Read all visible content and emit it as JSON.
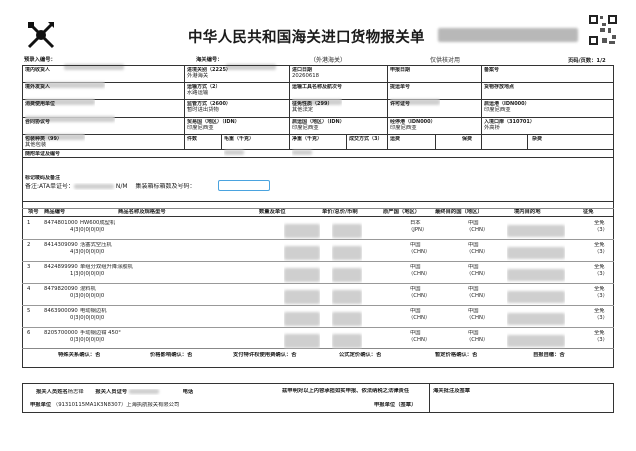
{
  "header": {
    "title": "中华人民共和国海关进口货物报关单",
    "preentry_label": "预录入编号：",
    "customs_no_label": "海关编号：",
    "customs_note": "（外港海关）",
    "usage": "仅供核对用",
    "page": "页码/页数：1/2"
  },
  "fields": {
    "consignee_domestic": "境内收货人",
    "entry_customs_label": "进境关别（2225）",
    "entry_customs_value": "外港海关",
    "import_date_label": "进口日期",
    "import_date_value": "20260618",
    "declare_date_label": "申报日期",
    "record_no_label": "备案号",
    "consignor_overseas": "境外发货人",
    "transport_mode_label": "运输方式（2）",
    "transport_mode_value": "水路运输",
    "vessel_label": "运输工具名称及航次号",
    "bill_no_label": "提运单号",
    "storage_label": "货物存放地点",
    "consumer_unit": "消费使用单位",
    "supervision_label": "监管方式（2600）",
    "supervision_value": "暂时进出货物",
    "tax_nature_label": "征免性质（299）",
    "tax_nature_value": "其他法定",
    "license_label": "许可证号",
    "departure_port_label": "启运港（IDN000）",
    "departure_port_value": "印度尼西亚",
    "contract_label": "合同协议号",
    "trade_country_label": "贸易国（地区）（IDN）",
    "trade_country_value": "印度尼西亚",
    "origin_country_label": "启运国（地区）（IDN）",
    "origin_country_value": "印度尼西亚",
    "via_port_label": "经停港（IDN000）",
    "via_port_value": "印度尼西亚",
    "entry_port_label": "入境口岸（310701）",
    "entry_port_value": "外高桥",
    "packaging_label": "包装种类（99）",
    "packaging_value": "其他包装",
    "pieces_label": "件数",
    "gross_label": "毛重（千克）",
    "net_label": "净重（千克）",
    "deal_mode_label": "成交方式（3）",
    "freight_label": "运费",
    "insurance_label": "保费",
    "misc_label": "杂费",
    "docs_label": "随附单证及编号",
    "marks_label": "标记唛码及备注",
    "remark_prefix": "备注:ATA单证号：",
    "remark_nm": "N/M",
    "remark_container": "集装箱标箱数及号码："
  },
  "goods_header": {
    "no": "项号",
    "code": "商品编号",
    "name": "商品名称及规格型号",
    "qty_unit": "数量及单位",
    "price": "单价/总价/币制",
    "origin": "原产国（地区）",
    "final_dest": "最终目的国（地区）",
    "domestic_dest": "境内目的地",
    "tax": "征免"
  },
  "goods": [
    {
      "no": "1",
      "code": "8474801000",
      "name": "HW600成型机",
      "spec": "4|3|0|0|0|0|0",
      "origin": "日本",
      "origin_code": "（JPN）",
      "dest": "中国",
      "dest_code": "（CHN）",
      "tax": "全免",
      "tax_code": "（3）"
    },
    {
      "no": "2",
      "code": "8414309090",
      "name": "活塞式空压机",
      "spec": "4|3|0|0|0|0|0",
      "origin": "中国",
      "origin_code": "（CHN）",
      "dest": "中国",
      "dest_code": "（CHN）",
      "tax": "全免",
      "tax_code": "（3）"
    },
    {
      "no": "3",
      "code": "8424899990",
      "name": "单组分双组升降涂胶机",
      "spec": "1|3|0|0|0|0|0",
      "origin": "中国",
      "origin_code": "（CHN）",
      "dest": "中国",
      "dest_code": "（CHN）",
      "tax": "全免",
      "tax_code": "（3）"
    },
    {
      "no": "4",
      "code": "8479820090",
      "name": "混料机",
      "spec": "0|3|0|0|0|0|0",
      "origin": "中国",
      "origin_code": "（CHN）",
      "dest": "中国",
      "dest_code": "（CHN）",
      "tax": "全免",
      "tax_code": "（3）"
    },
    {
      "no": "5",
      "code": "8463900090",
      "name": "电动钢边机",
      "spec": "0|3|0|0|0|0|0",
      "origin": "中国",
      "origin_code": "（CHN）",
      "dest": "中国",
      "dest_code": "（CHN）",
      "tax": "全免",
      "tax_code": "（3）"
    },
    {
      "no": "6",
      "code": "8205700000",
      "name": "手动钢边钳 450°",
      "spec": "0|3|0|0|0|0|0",
      "origin": "中国",
      "origin_code": "（CHN）",
      "dest": "中国",
      "dest_code": "（CHN）",
      "tax": "全免",
      "tax_code": "（3）"
    }
  ],
  "footer": {
    "special_relation": "特殊关系确认：否",
    "price_impact": "价格影响确认：否",
    "royalty": "支付特许权使用费确认：否",
    "self_report": "公式定价确认：否",
    "provisional_price": "暂定价格确认：否",
    "self_pay": "自报自缴：否",
    "declarant": "报关人员姓名",
    "declarant_name": "杨志锋",
    "declarant_cert": "报关人员证号",
    "phone": "电话",
    "statement": "兹申明对以上内容承担如实申报、依法纳税之法律责任",
    "customs_remark": "海关批注及签章",
    "declare_unit_prefix": "申报单位",
    "declare_unit": "（91310115MA1K3N8307）上海执航报关有限公司",
    "declare_seal": "申报单位（签章）"
  }
}
